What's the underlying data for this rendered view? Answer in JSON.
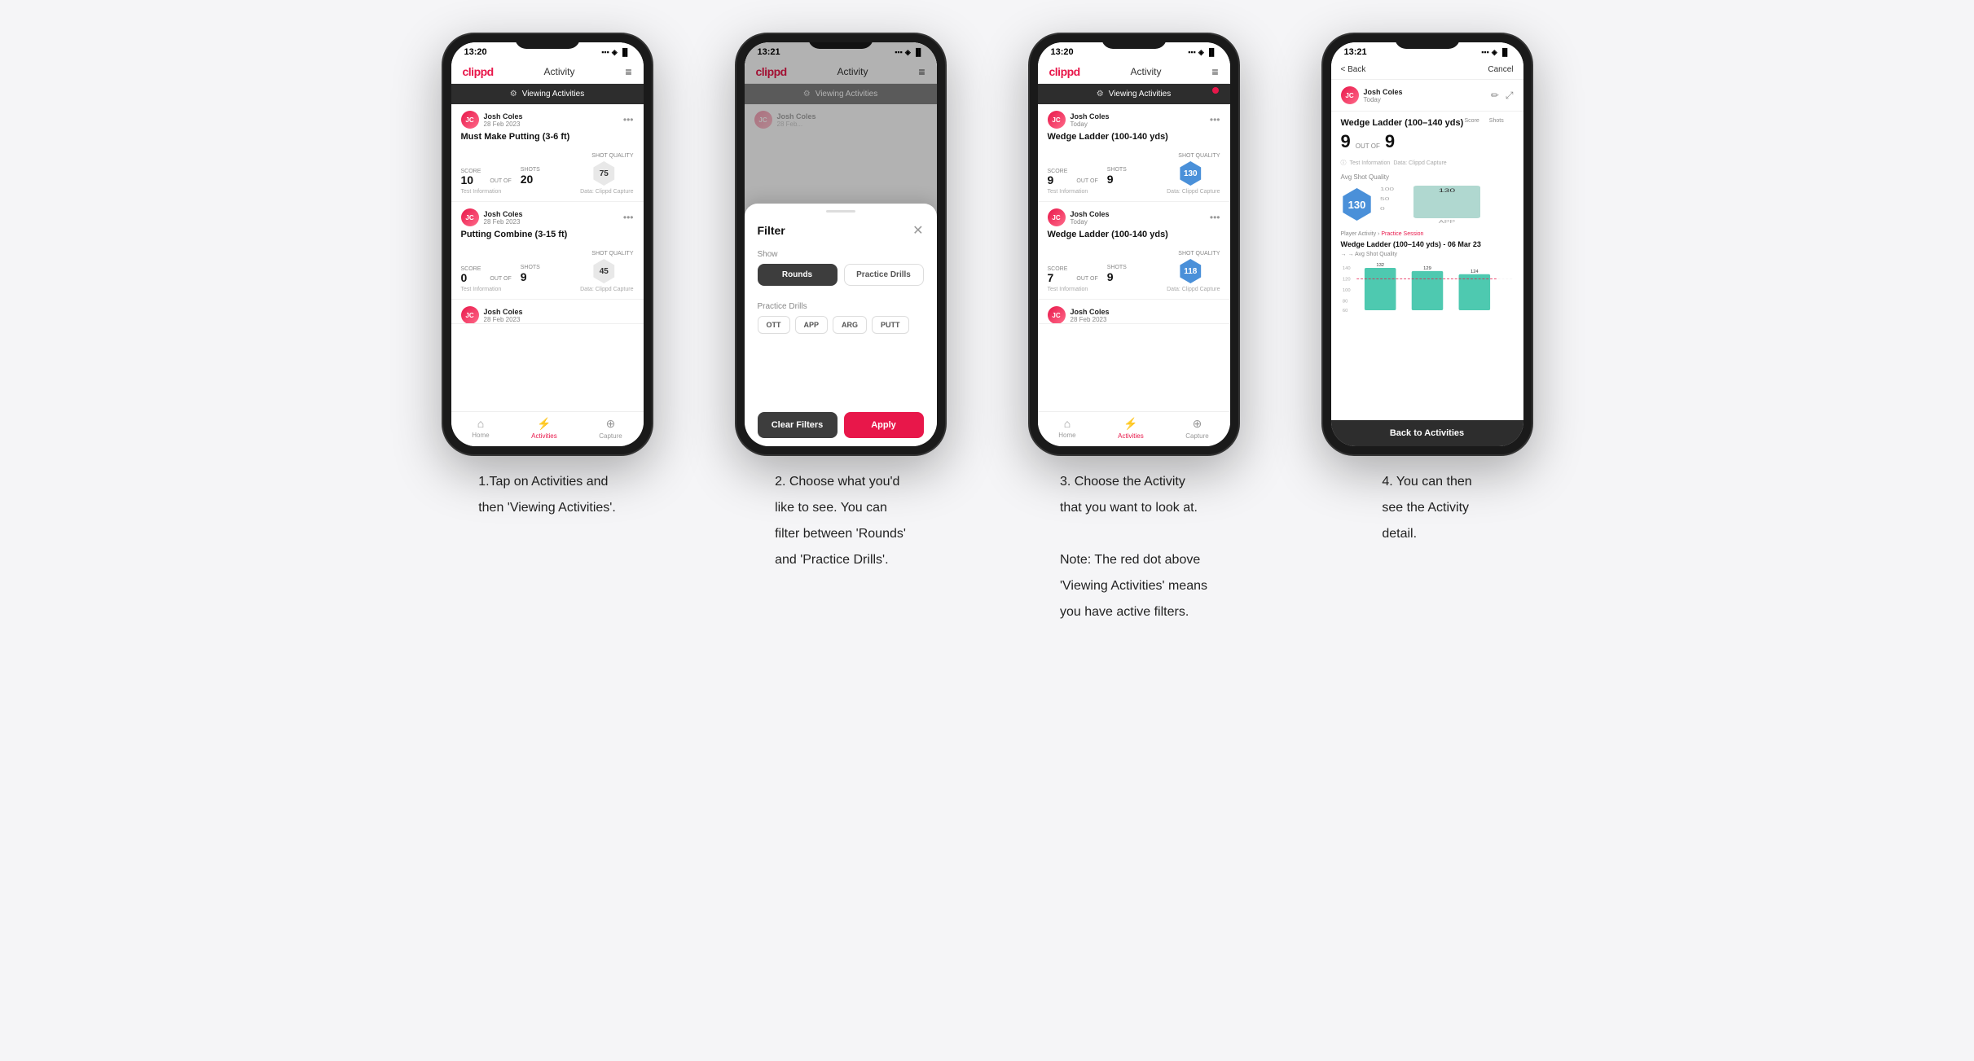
{
  "phones": [
    {
      "id": "phone1",
      "statusTime": "13:20",
      "appTitle": "Activity",
      "logoText": "clippd",
      "viewingBar": "Viewing Activities",
      "hasRedDot": false,
      "cards": [
        {
          "userName": "Josh Coles",
          "userDate": "28 Feb 2023",
          "activityName": "Must Make Putting (3-6 ft)",
          "scoreLabel": "Score",
          "shotsLabel": "Shots",
          "shotQualityLabel": "Shot Quality",
          "score": "10",
          "outOf": "20",
          "shotQuality": "75",
          "isBlue": false,
          "infoLeft": "Test Information",
          "infoRight": "Data: Clippd Capture"
        },
        {
          "userName": "Josh Coles",
          "userDate": "28 Feb 2023",
          "activityName": "Putting Combine (3-15 ft)",
          "scoreLabel": "Score",
          "shotsLabel": "Shots",
          "shotQualityLabel": "Shot Quality",
          "score": "0",
          "outOf": "9",
          "shotQuality": "45",
          "isBlue": false,
          "infoLeft": "Test Information",
          "infoRight": "Data: Clippd Capture"
        },
        {
          "userName": "Josh Coles",
          "userDate": "28 Feb 2023",
          "activityName": "",
          "score": "",
          "outOf": "",
          "shotQuality": "",
          "isBlue": false,
          "infoLeft": "",
          "infoRight": ""
        }
      ],
      "bottomNav": [
        {
          "label": "Home",
          "icon": "⌂",
          "active": false
        },
        {
          "label": "Activities",
          "icon": "⚡",
          "active": true
        },
        {
          "label": "Capture",
          "icon": "⊕",
          "active": false
        }
      ]
    },
    {
      "id": "phone2",
      "statusTime": "13:21",
      "appTitle": "Activity",
      "logoText": "clippd",
      "viewingBar": "Viewing Activities",
      "hasRedDot": false,
      "showModal": true,
      "modal": {
        "title": "Filter",
        "showLabel": "Show",
        "roundsLabel": "Rounds",
        "practiceDrillsLabel": "Practice Drills",
        "practiceDrillsSectionLabel": "Practice Drills",
        "drillTypes": [
          "OTT",
          "APP",
          "ARG",
          "PUTT"
        ],
        "clearFiltersLabel": "Clear Filters",
        "applyLabel": "Apply"
      }
    },
    {
      "id": "phone3",
      "statusTime": "13:20",
      "appTitle": "Activity",
      "logoText": "clippd",
      "viewingBar": "Viewing Activities",
      "hasRedDot": true,
      "cards": [
        {
          "userName": "Josh Coles",
          "userDate": "Today",
          "activityName": "Wedge Ladder (100-140 yds)",
          "scoreLabel": "Score",
          "shotsLabel": "Shots",
          "shotQualityLabel": "Shot Quality",
          "score": "9",
          "outOf": "9",
          "shotQuality": "130",
          "isBlue": true,
          "infoLeft": "Test Information",
          "infoRight": "Data: Clippd Capture"
        },
        {
          "userName": "Josh Coles",
          "userDate": "Today",
          "activityName": "Wedge Ladder (100-140 yds)",
          "scoreLabel": "Score",
          "shotsLabel": "Shots",
          "shotQualityLabel": "Shot Quality",
          "score": "7",
          "outOf": "9",
          "shotQuality": "118",
          "isBlue": true,
          "infoLeft": "Test Information",
          "infoRight": "Data: Clippd Capture"
        },
        {
          "userName": "Josh Coles",
          "userDate": "28 Feb 2023",
          "activityName": "",
          "score": "",
          "outOf": "",
          "shotQuality": "",
          "isBlue": false,
          "infoLeft": "",
          "infoRight": ""
        }
      ],
      "bottomNav": [
        {
          "label": "Home",
          "icon": "⌂",
          "active": false
        },
        {
          "label": "Activities",
          "icon": "⚡",
          "active": true
        },
        {
          "label": "Capture",
          "icon": "⊕",
          "active": false
        }
      ]
    },
    {
      "id": "phone4",
      "statusTime": "13:21",
      "logoText": "clippd",
      "backLabel": "< Back",
      "cancelLabel": "Cancel",
      "userName": "Josh Coles",
      "userDate": "Today",
      "drillName": "Wedge Ladder (100–140 yds)",
      "scoreColLabel": "Score",
      "shotsColLabel": "Shots",
      "score": "9",
      "outOf": "9",
      "infoText": "Test Information",
      "captureText": "Data: Clippd Capture",
      "avgShotQualityLabel": "Avg Shot Quality",
      "avgShotQuality": "130",
      "chartLabels": [
        "",
        "APP"
      ],
      "chartValue": "130",
      "practiceSessionPrefix": "Player Activity ›",
      "practiceSessionLink": "Practice Session",
      "sectionTitle": "Wedge Ladder (100–140 yds) - 06 Mar 23",
      "sectionSubtitle": "→ → Avg Shot Quality",
      "barData": [
        {
          "label": "132",
          "value": 88
        },
        {
          "label": "129",
          "value": 86
        },
        {
          "label": "124",
          "value": 83
        }
      ],
      "yLabels": [
        "140",
        "120",
        "100",
        "80",
        "60"
      ],
      "backToActivities": "Back to Activities"
    }
  ],
  "descriptions": [
    {
      "id": "desc1",
      "lines": [
        "1.Tap on Activities and",
        "then 'Viewing Activities'."
      ]
    },
    {
      "id": "desc2",
      "lines": [
        "2. Choose what you'd",
        "like to see. You can",
        "filter between 'Rounds'",
        "and 'Practice Drills'."
      ]
    },
    {
      "id": "desc3",
      "lines": [
        "3. Choose the Activity",
        "that you want to look at.",
        "",
        "Note: The red dot above",
        "'Viewing Activities' means",
        "you have active filters."
      ]
    },
    {
      "id": "desc4",
      "lines": [
        "4. You can then",
        "see the Activity",
        "detail."
      ]
    }
  ]
}
